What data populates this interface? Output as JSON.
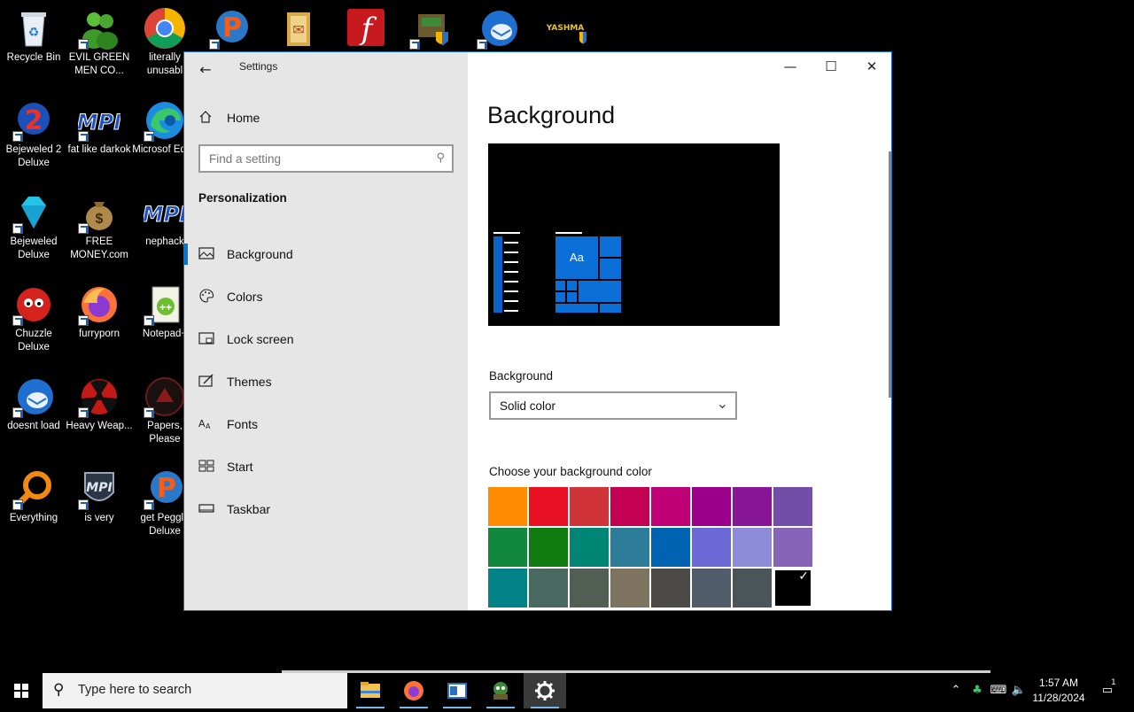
{
  "desktop": {
    "icons": [
      {
        "label": "Recycle Bin",
        "icon": "recycle-bin-icon"
      },
      {
        "label": "EVIL GREEN MEN CO...",
        "icon": "messenger-people-icon"
      },
      {
        "label": "literally unusabl",
        "icon": "chrome-icon"
      },
      {
        "label": "",
        "icon": "peggle-p-icon"
      },
      {
        "label": "",
        "icon": "folder-app-icon"
      },
      {
        "label": "",
        "icon": "flash-icon"
      },
      {
        "label": "",
        "icon": "game-shield-icon"
      },
      {
        "label": "",
        "icon": "thunderbird-icon"
      },
      {
        "label": "YASHMA",
        "icon": "yashma-shield-icon"
      },
      {
        "label": "Bejeweled 2 Deluxe",
        "icon": "bejeweled2-icon"
      },
      {
        "label": "fat like darkok",
        "icon": "mpi-icon"
      },
      {
        "label": "Microsof Edge",
        "icon": "edge-icon"
      },
      {
        "label": "Bejeweled Deluxe",
        "icon": "diamond-icon"
      },
      {
        "label": "FREE MONEY.com",
        "icon": "money-bag-icon"
      },
      {
        "label": "nephack",
        "icon": "mpi-icon"
      },
      {
        "label": "Chuzzle Deluxe",
        "icon": "chuzzle-icon"
      },
      {
        "label": "furryporn",
        "icon": "firefox-icon"
      },
      {
        "label": "Notepad+",
        "icon": "notepad-plus-icon"
      },
      {
        "label": "doesnt load",
        "icon": "thunderbird-icon"
      },
      {
        "label": "Heavy Weap...",
        "icon": "radiation-icon"
      },
      {
        "label": "Papers, Please",
        "icon": "papers-please-icon"
      },
      {
        "label": "Everything",
        "icon": "everything-search-icon"
      },
      {
        "label": "is very",
        "icon": "mpi-shield-icon"
      },
      {
        "label": "get Peggle Deluxe",
        "icon": "peggle-p-icon"
      }
    ]
  },
  "window": {
    "title": "Settings",
    "back": "←",
    "minimize": "—",
    "maximize": "☐",
    "close": "✕"
  },
  "nav": {
    "home": "Home",
    "search_placeholder": "Find a setting",
    "section": "Personalization",
    "items": [
      {
        "label": "Background",
        "icon": "picture-icon",
        "active": true
      },
      {
        "label": "Colors",
        "icon": "palette-icon",
        "active": false
      },
      {
        "label": "Lock screen",
        "icon": "lock-screen-icon",
        "active": false
      },
      {
        "label": "Themes",
        "icon": "themes-icon",
        "active": false
      },
      {
        "label": "Fonts",
        "icon": "fonts-icon",
        "active": false
      },
      {
        "label": "Start",
        "icon": "start-icon",
        "active": false
      },
      {
        "label": "Taskbar",
        "icon": "taskbar-icon",
        "active": false
      }
    ]
  },
  "content": {
    "title": "Background",
    "preview_tile_text": "Aa",
    "background_label": "Background",
    "background_value": "Solid color",
    "color_label": "Choose your background color",
    "colors": [
      "#ff8c00",
      "#e81123",
      "#d13438",
      "#c30052",
      "#bf0077",
      "#9a0089",
      "#881798",
      "#744da9",
      "#10893e",
      "#107c10",
      "#018574",
      "#2d7d9a",
      "#0063b1",
      "#6b69d6",
      "#8e8cd8",
      "#8764b8",
      "#038387",
      "#486860",
      "#525e54",
      "#7e735f",
      "#4c4a48",
      "#515c6b",
      "#4a5459",
      "#000000"
    ],
    "selected_color": "#000000",
    "check": "✓"
  },
  "taskbar": {
    "search_text": "Type here to search",
    "time": "1:57 AM",
    "date": "11/28/2024",
    "notification_count": "1",
    "apps": [
      "file-explorer-icon",
      "firefox-icon",
      "word-pad-icon",
      "game-shield-icon",
      "settings-gear-icon"
    ]
  }
}
